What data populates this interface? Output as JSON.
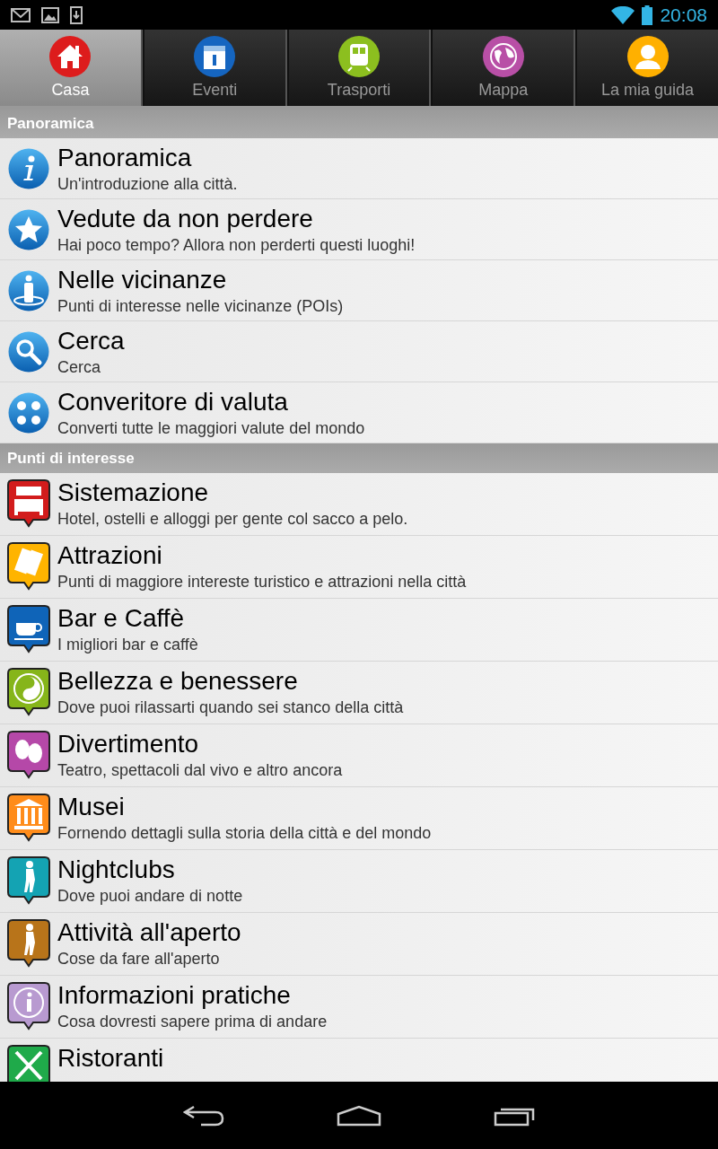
{
  "status_bar": {
    "time": "20:08"
  },
  "tabs": [
    {
      "label": "Casa",
      "selected": true,
      "color": "#dd1c1c"
    },
    {
      "label": "Eventi",
      "selected": false,
      "color": "#1565c0"
    },
    {
      "label": "Trasporti",
      "selected": false,
      "color": "#8cbf1f"
    },
    {
      "label": "Mappa",
      "selected": false,
      "color": "#b84fa6"
    },
    {
      "label": "La mia guida",
      "selected": false,
      "color": "#ffb000"
    }
  ],
  "sections": [
    {
      "title": "Panoramica",
      "items": [
        {
          "kind": "round",
          "title": "Panoramica",
          "subtitle": "Un'introduzione alla città."
        },
        {
          "kind": "round",
          "title": "Vedute da non perdere",
          "subtitle": "Hai poco tempo? Allora non perderti questi luoghi!"
        },
        {
          "kind": "round",
          "title": "Nelle vicinanze",
          "subtitle": "Punti di interesse nelle vicinanze (POIs)"
        },
        {
          "kind": "round",
          "title": "Cerca",
          "subtitle": "Cerca"
        },
        {
          "kind": "round",
          "title": "Converitore di valuta",
          "subtitle": "Converti tutte le maggiori valute del mondo"
        }
      ]
    },
    {
      "title": "Punti di interesse",
      "items": [
        {
          "kind": "pin",
          "color": "#d21c1c",
          "title": "Sistemazione",
          "subtitle": "Hotel, ostelli e alloggi per gente col sacco a pelo."
        },
        {
          "kind": "pin",
          "color": "#ffb400",
          "title": "Attrazioni",
          "subtitle": "Punti di maggiore intereste turistico e attrazioni nella città"
        },
        {
          "kind": "pin",
          "color": "#0f64b8",
          "title": "Bar e Caffè",
          "subtitle": "I migliori bar e caffè"
        },
        {
          "kind": "pin",
          "color": "#86b51a",
          "title": "Bellezza e benessere",
          "subtitle": "Dove puoi rilassarti quando sei stanco della città"
        },
        {
          "kind": "pin",
          "color": "#b548a8",
          "title": "Divertimento",
          "subtitle": "Teatro, spettacoli dal vivo e altro ancora"
        },
        {
          "kind": "pin",
          "color": "#ff8c1a",
          "title": "Musei",
          "subtitle": "Fornendo dettagli sulla storia della città e del mondo"
        },
        {
          "kind": "pin",
          "color": "#14a3b3",
          "title": "Nightclubs",
          "subtitle": "Dove puoi andare di notte"
        },
        {
          "kind": "pin",
          "color": "#b8741a",
          "title": "Attività all'aperto",
          "subtitle": "Cose da fare all'aperto"
        },
        {
          "kind": "pin",
          "color": "#b89ad0",
          "title": "Informazioni pratiche",
          "subtitle": "Cosa dovresti sapere prima di andare"
        },
        {
          "kind": "pin",
          "color": "#1faa4a",
          "title": "Ristoranti"
        }
      ]
    }
  ]
}
